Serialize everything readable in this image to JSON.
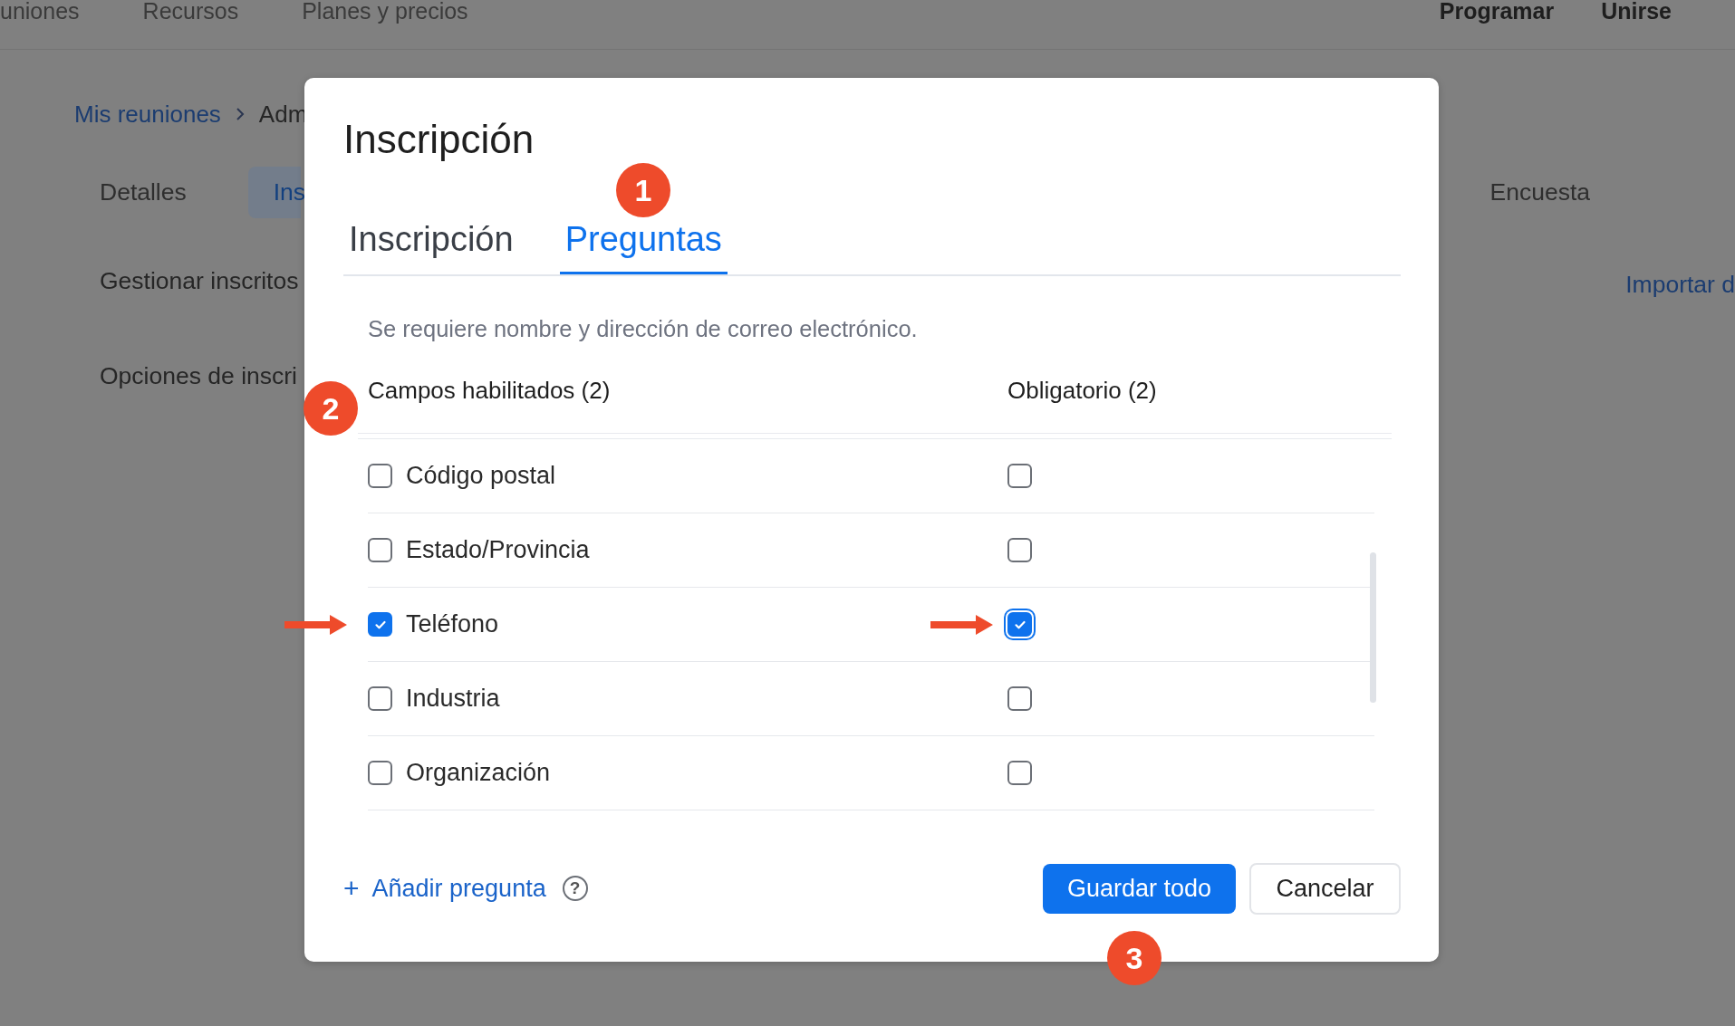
{
  "header": {
    "nav_left": [
      "uniones",
      "Recursos",
      "Planes y precios"
    ],
    "nav_right": [
      "Programar",
      "Unirse"
    ]
  },
  "breadcrumb": [
    {
      "label": "Mis reuniones",
      "link": true
    },
    {
      "label": "Adm",
      "link": false
    }
  ],
  "page_tabs": [
    {
      "label": "Detalles",
      "selected": false
    },
    {
      "label": "Ins",
      "selected": true
    },
    {
      "label": "Encuesta",
      "selected": false
    }
  ],
  "side_items": [
    "Gestionar inscritos",
    "Opciones de inscri"
  ],
  "import_link": "Importar d",
  "dialog": {
    "title": "Inscripción",
    "tabs": [
      {
        "label": "Inscripción",
        "selected": false
      },
      {
        "label": "Preguntas",
        "selected": true
      }
    ],
    "tabs_callout": "1",
    "note": "Se requiere nombre y dirección de correo electrónico.",
    "columns": [
      "Campos habilitados (2)",
      "Obligatorio (2)"
    ],
    "columns_callout": "2",
    "fields": [
      {
        "label": "Código postal",
        "enabled": false,
        "required": false,
        "pointed": false,
        "focused": false
      },
      {
        "label": "Estado/Provincia",
        "enabled": false,
        "required": false,
        "pointed": false,
        "focused": false
      },
      {
        "label": "Teléfono",
        "enabled": true,
        "required": true,
        "pointed": true,
        "focused": true
      },
      {
        "label": "Industria",
        "enabled": false,
        "required": false,
        "pointed": false,
        "focused": false
      },
      {
        "label": "Organización",
        "enabled": false,
        "required": false,
        "pointed": false,
        "focused": false
      }
    ],
    "add_icon": "+",
    "add_question": "Añadir pregunta",
    "help_icon": "?",
    "save_button": "Guardar todo",
    "save_callout": "3",
    "cancel_button": "Cancelar"
  }
}
